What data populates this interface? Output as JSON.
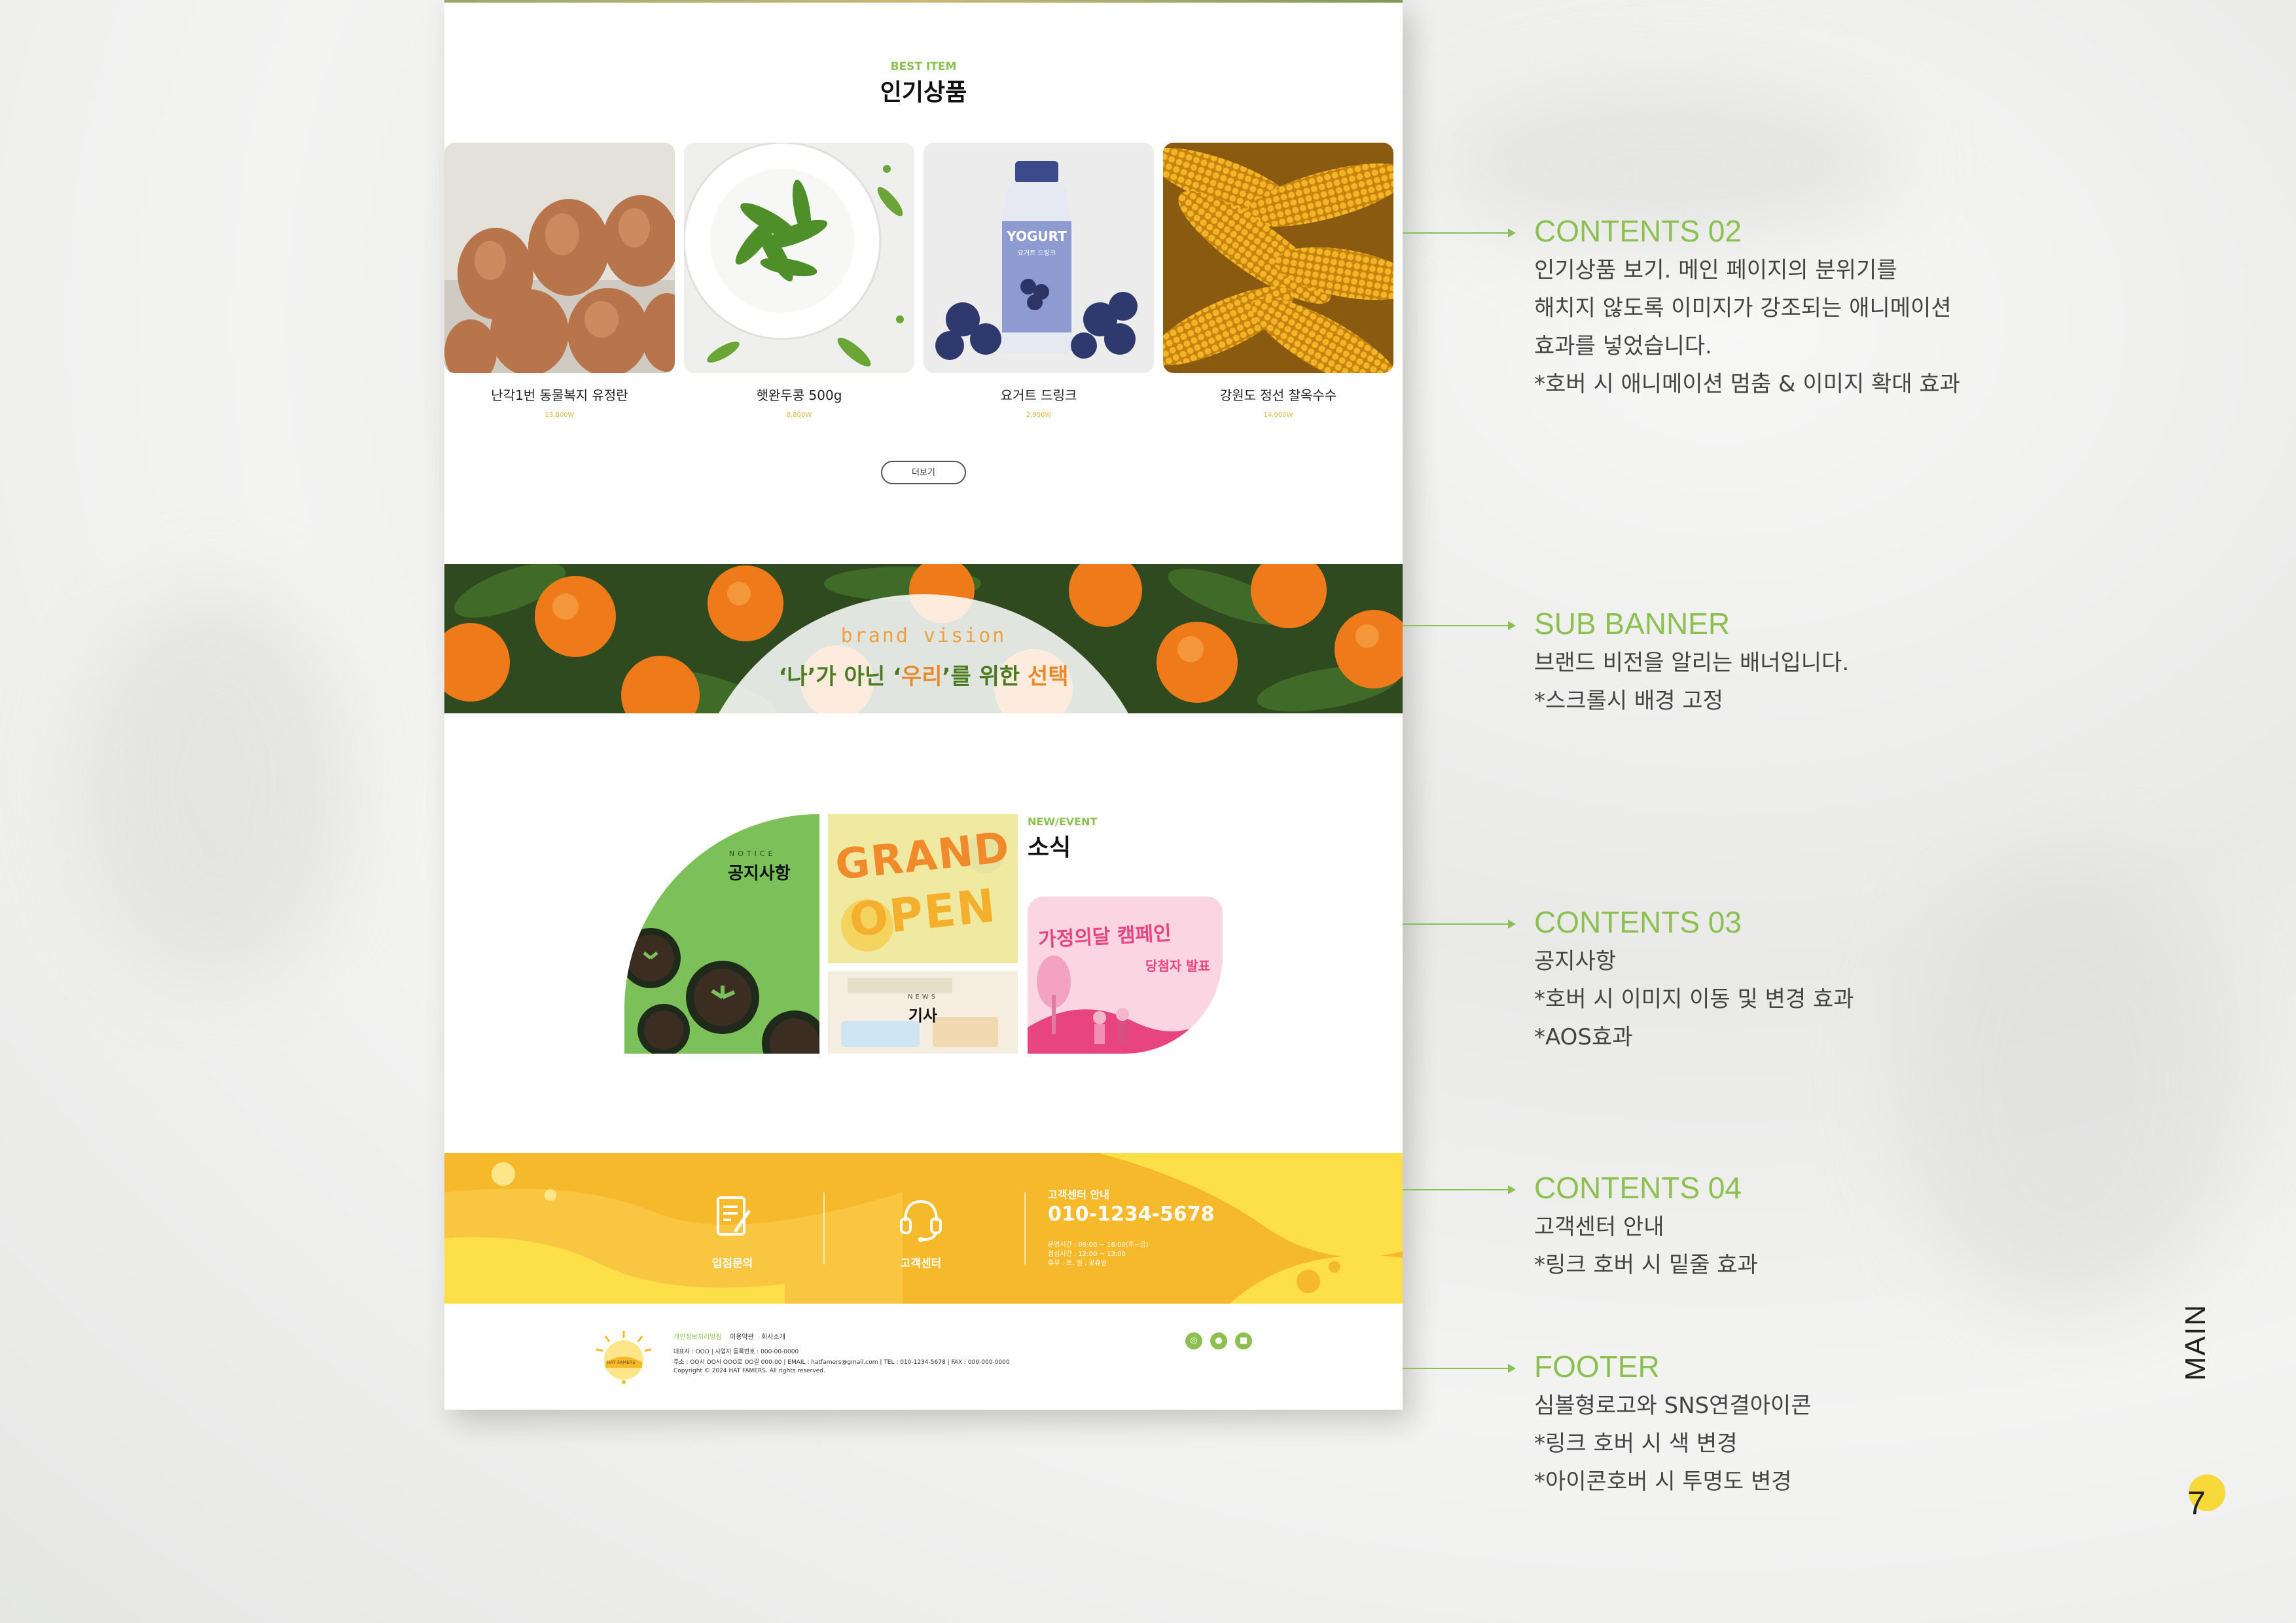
{
  "best": {
    "eng": "BEST ITEM",
    "kor": "인기상품",
    "more": "더보기"
  },
  "products": [
    {
      "name": "난각1번 동물복지 유정란",
      "price": "13,800W"
    },
    {
      "name": "햇완두콩 500g",
      "price": "8,800W"
    },
    {
      "name": "요거트 드링크",
      "price": "2,900W"
    },
    {
      "name": "강원도 정선 찰옥수수",
      "price": "14,900W"
    }
  ],
  "yogurt_label": {
    "brand": "YOGURT",
    "sub": "요거트 드링크"
  },
  "sub_banner": {
    "eng": "brand vision",
    "kor_part1": "‘나’가 아닌 ‘",
    "kor_part2": "우리",
    "kor_part3": "’를 위한 ",
    "kor_part4": "선택"
  },
  "news": {
    "eng": "NEW/EVENT",
    "kor": "소식",
    "notice_eng": "NOTICE",
    "notice_kor": "공지사항",
    "grand1": "GRAND",
    "grand2": "OPEN",
    "article_eng": "NEWS",
    "article_kor": "기사",
    "campaign": "가정의달 캠페인",
    "campaign_sub": "당첨자 발표"
  },
  "cs": {
    "item1": "입점문의",
    "item2": "고객센터",
    "title": "고객센터 안내",
    "phone": "010-1234-5678",
    "hours1": "운영시간 : 09:00 ~ 18:00(주~금)",
    "hours2": "점심시간 : 12:00 ~ 13:00",
    "hours3": "휴무 : 토, 일 , 공휴일"
  },
  "footer": {
    "links": [
      "개인정보처리방침",
      "이용약관",
      "회사소개"
    ],
    "logo_text": "HAT FAMERS",
    "info1": "대표자 : OOO  |  사업자 등록번호 : 000-00-0000",
    "info2": "주소 : OO시 OO시 OOO로 OO길 000-00  |  EMAIL : hatfamers@gmail.com  |  TEL : 010-1234-5678  |  FAX : 000-000-0000",
    "copyright": "Copyright © 2024 HAT FAMERS. All rights reserved.",
    "sns": [
      "instagram-icon",
      "kakao-icon",
      "blog-icon"
    ]
  },
  "annotations": [
    {
      "title": "CONTENTS 02",
      "lines": [
        "인기상품 보기. 메인 페이지의 분위기를",
        "해치지 않도록 이미지가 강조되는 애니메이션",
        "효과를 넣었습니다.",
        "*호버 시 애니메이션 멈춤 & 이미지 확대 효과"
      ]
    },
    {
      "title": "SUB BANNER",
      "lines": [
        "브랜드 비전을 알리는 배너입니다.",
        "*스크롤시 배경 고정"
      ]
    },
    {
      "title": "CONTENTS 03",
      "lines": [
        "공지사항",
        "*호버 시 이미지 이동 및 변경 효과",
        "*AOS효과"
      ]
    },
    {
      "title": "CONTENTS 04",
      "lines": [
        "고객센터 안내",
        "*링크 호버 시 밑줄 효과"
      ]
    },
    {
      "title": "FOOTER",
      "lines": [
        "심볼형로고와 SNS연결아이콘",
        "*링크 호버 시 색 변경",
        "*아이콘호버 시 투명도 변경"
      ]
    }
  ],
  "side": {
    "label": "MAIN",
    "page": "7"
  },
  "colors": {
    "accent_green": "#8cc152",
    "cs_yellow": "#f6b92b",
    "orange": "#e8892a"
  }
}
